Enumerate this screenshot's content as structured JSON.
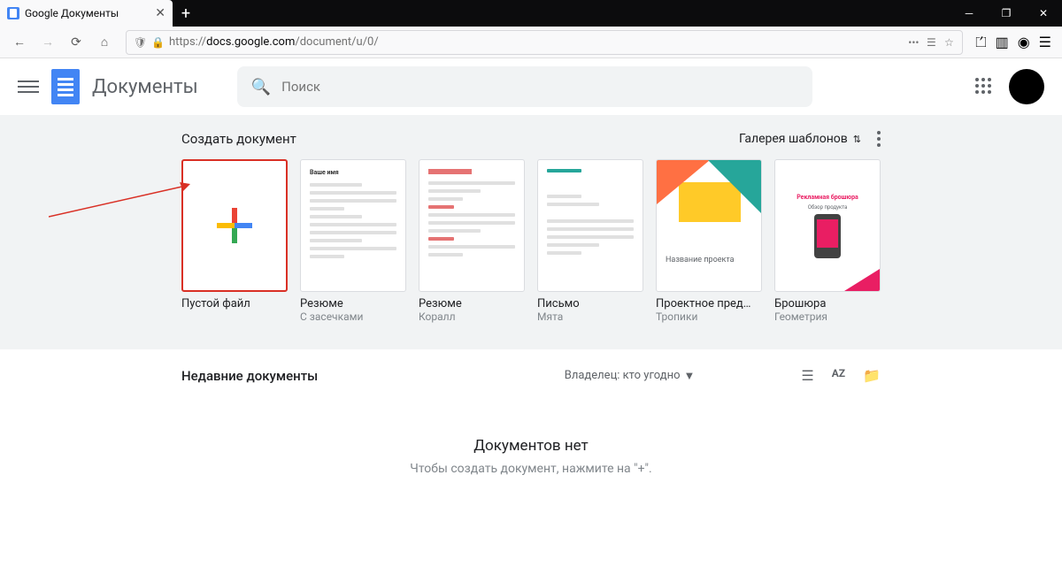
{
  "browser": {
    "tab_title": "Google Документы",
    "url_prefix": "https://",
    "url_host": "docs.google.com",
    "url_path": "/document/u/0/"
  },
  "docs": {
    "app_name": "Документы",
    "search_placeholder": "Поиск"
  },
  "templates": {
    "heading": "Создать документ",
    "gallery_label": "Галерея шаблонов",
    "items": [
      {
        "label": "Пустой файл",
        "sub": ""
      },
      {
        "label": "Резюме",
        "sub": "С засечками"
      },
      {
        "label": "Резюме",
        "sub": "Коралл"
      },
      {
        "label": "Письмо",
        "sub": "Мята"
      },
      {
        "label": "Проектное пред…",
        "sub": "Тропики"
      },
      {
        "label": "Брошюра",
        "sub": "Геометрия"
      }
    ],
    "project_text": "Название проекта",
    "brochure_title": "Рекламная брошюра",
    "brochure_sub": "Обзор продукта",
    "resume_name": "Ваше имя"
  },
  "recent": {
    "heading": "Недавние документы",
    "owner_filter": "Владелец: кто угодно",
    "empty_title": "Документов нет",
    "empty_sub": "Чтобы создать документ, нажмите на \"+\"."
  }
}
